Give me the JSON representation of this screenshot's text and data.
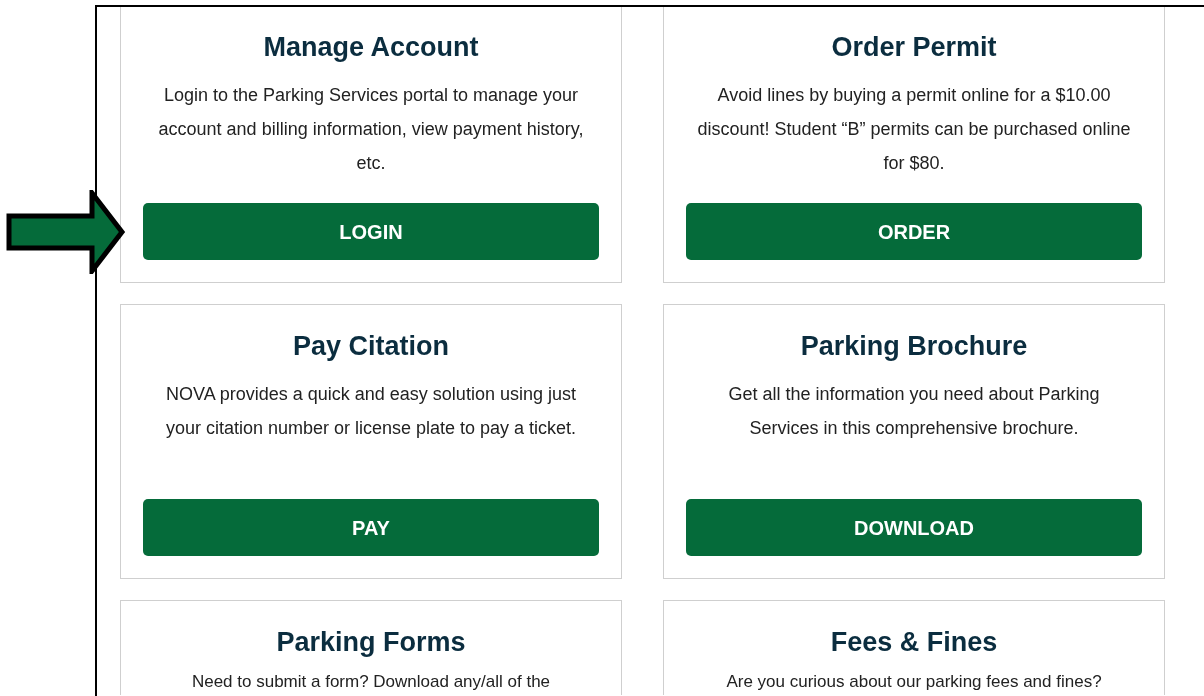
{
  "cards": [
    {
      "title": "Manage Account",
      "description": "Login to the Parking Services portal to manage your account and billing information, view payment history, etc.",
      "button": "LOGIN"
    },
    {
      "title": "Order Permit",
      "description": "Avoid lines by buying a permit online for a $10.00 discount! Student “B” permits can be purchased online for $80.",
      "button": "ORDER"
    },
    {
      "title": "Pay Citation",
      "description": "NOVA provides a quick and easy solution using just your citation number or license plate to pay a ticket.",
      "button": "PAY"
    },
    {
      "title": "Parking Brochure",
      "description": "Get all the information you need about Parking Services in this comprehensive brochure.",
      "button": "DOWNLOAD"
    },
    {
      "title": "Parking Forms",
      "description": "Need to submit a form? Download any/all of the"
    },
    {
      "title": "Fees & Fines",
      "description": "Are you curious about our parking fees and fines?"
    }
  ]
}
